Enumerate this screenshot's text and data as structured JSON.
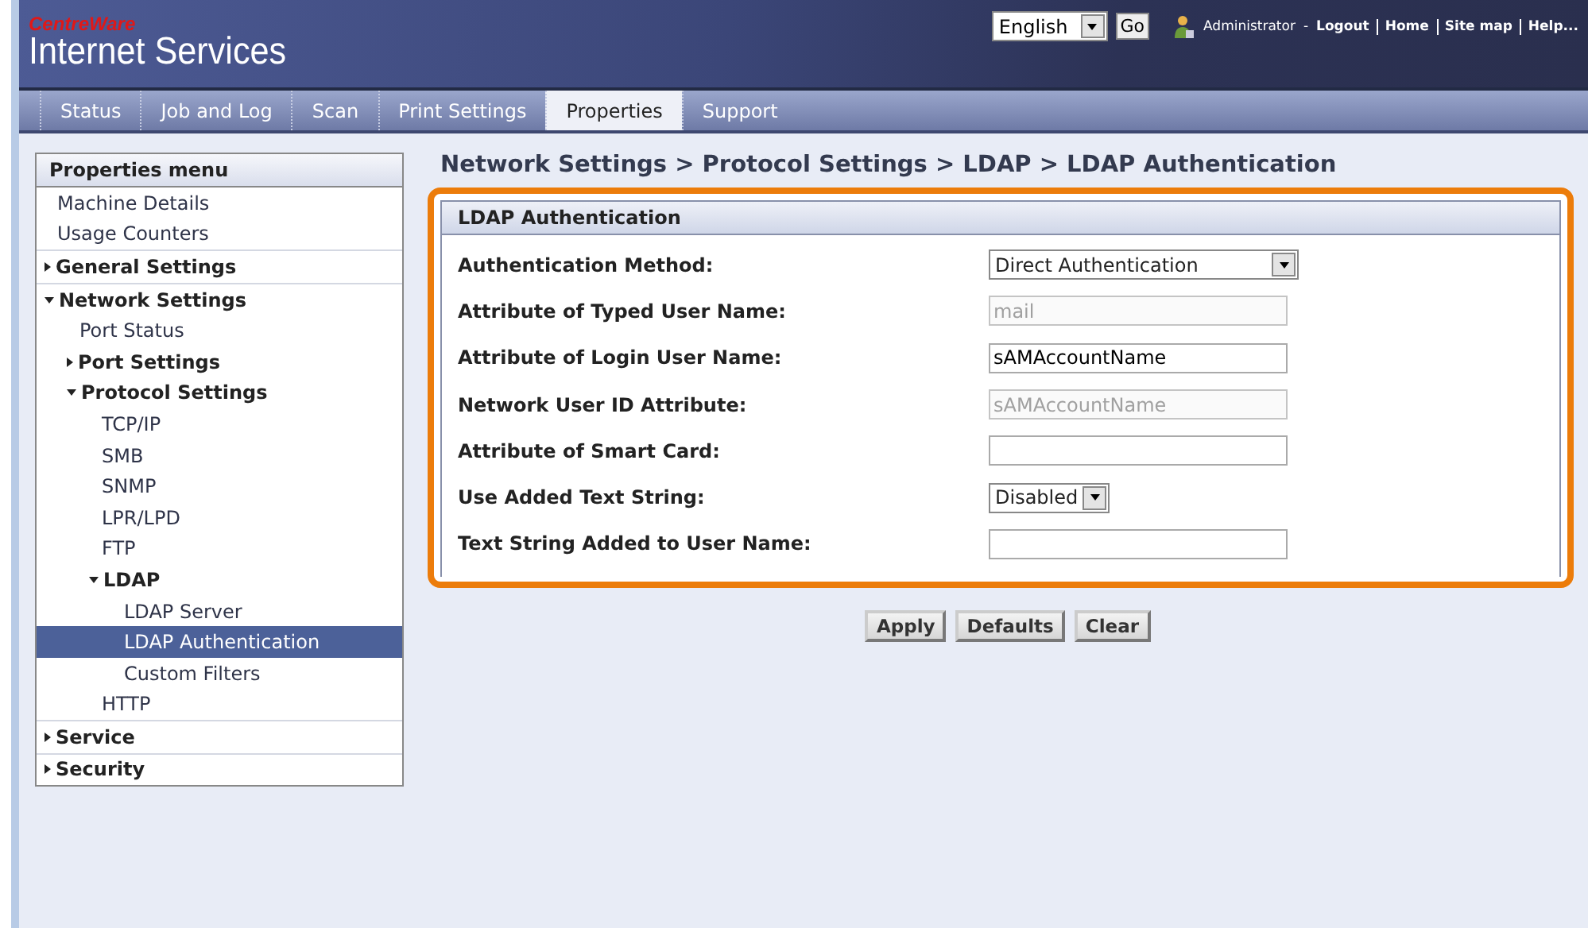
{
  "header": {
    "brand_top": "CentreWare",
    "brand": "Internet Services",
    "language": {
      "value": "English",
      "go": "Go"
    },
    "user": "Administrator",
    "separator": "-",
    "links": [
      {
        "label": "Logout",
        "kind": "logout"
      },
      {
        "label": "Home",
        "kind": "link"
      },
      {
        "label": "Site map",
        "kind": "link"
      },
      {
        "label": "Help...",
        "kind": "link"
      }
    ]
  },
  "tabs": [
    {
      "label": "Status",
      "selected": false
    },
    {
      "label": "Job and Log",
      "selected": false
    },
    {
      "label": "Scan",
      "selected": false
    },
    {
      "label": "Print Settings",
      "selected": false
    },
    {
      "label": "Properties",
      "selected": true
    },
    {
      "label": "Support",
      "selected": false
    }
  ],
  "menu": {
    "title": "Properties menu",
    "items": [
      {
        "label": "Machine Details",
        "kind": "link",
        "selected": false
      },
      {
        "label": "Usage Counters",
        "kind": "link",
        "selected": false
      },
      {
        "label": "General Settings",
        "kind": "section",
        "expanded": false,
        "selected": false
      },
      {
        "label": "Network Settings",
        "kind": "section",
        "expanded": true,
        "selected": false,
        "children": [
          {
            "label": "Port Status",
            "kind": "link",
            "selected": false
          },
          {
            "label": "Port Settings",
            "kind": "section",
            "expanded": false,
            "selected": false
          },
          {
            "label": "Protocol Settings",
            "kind": "section",
            "expanded": true,
            "selected": false,
            "children": [
              {
                "label": "TCP/IP",
                "kind": "link",
                "selected": false
              },
              {
                "label": "SMB",
                "kind": "link",
                "selected": false
              },
              {
                "label": "SNMP",
                "kind": "link",
                "selected": false
              },
              {
                "label": "LPR/LPD",
                "kind": "link",
                "selected": false
              },
              {
                "label": "FTP",
                "kind": "link",
                "selected": false
              },
              {
                "label": "LDAP",
                "kind": "section",
                "expanded": true,
                "selected": false,
                "children": [
                  {
                    "label": "LDAP Server",
                    "kind": "link",
                    "selected": false
                  },
                  {
                    "label": "LDAP Authentication",
                    "kind": "link",
                    "selected": true
                  },
                  {
                    "label": "Custom Filters",
                    "kind": "link",
                    "selected": false
                  }
                ]
              },
              {
                "label": "HTTP",
                "kind": "link",
                "selected": false
              }
            ]
          }
        ]
      },
      {
        "label": "Service",
        "kind": "section",
        "expanded": false,
        "selected": false
      },
      {
        "label": "Security",
        "kind": "section",
        "expanded": false,
        "selected": false
      }
    ]
  },
  "breadcrumb": "Network Settings > Protocol Settings > LDAP > LDAP Authentication",
  "panel": {
    "title": "LDAP Authentication",
    "fields": [
      {
        "label": "Authentication Method:",
        "kind": "select",
        "value": "Direct Authentication",
        "disabled": false,
        "wide": true
      },
      {
        "label": "Attribute of Typed User Name:",
        "kind": "input",
        "value": "mail",
        "disabled": true
      },
      {
        "label": "Attribute of Login User Name:",
        "kind": "input",
        "value": "sAMAccountName",
        "disabled": false
      },
      {
        "label": "Network User ID Attribute:",
        "kind": "input",
        "value": "sAMAccountName",
        "disabled": true
      },
      {
        "label": "Attribute of Smart Card:",
        "kind": "input",
        "disabled": false
      },
      {
        "label": "Use Added Text String:",
        "kind": "select",
        "value": "Disabled",
        "disabled": false,
        "wide": false
      },
      {
        "label": "Text String Added to User Name:",
        "kind": "input",
        "disabled": false
      }
    ]
  },
  "buttons": [
    "Apply",
    "Defaults",
    "Clear"
  ]
}
